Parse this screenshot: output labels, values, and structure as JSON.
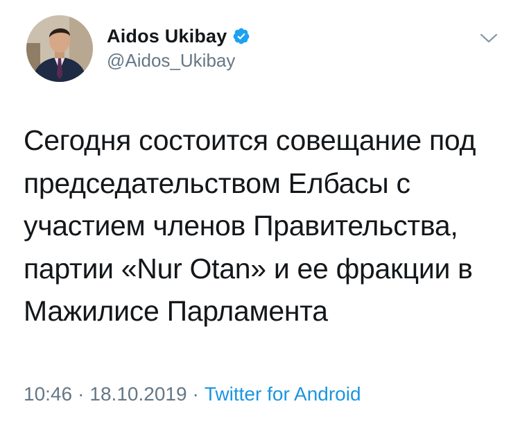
{
  "author": {
    "display_name": "Aidos Ukibay",
    "handle": "@Aidos_Ukibay",
    "verified": true,
    "verified_icon": "verified-badge-icon",
    "avatar_icon": "profile-photo"
  },
  "tweet": {
    "lines": [
      "Сегодня состоится совещание под",
      "председательством Елбасы с",
      "участием членов Правительства,",
      "партии «Nur Otan» и ее фракции в",
      "Мажилисе Парламента"
    ]
  },
  "meta": {
    "time": "10:46",
    "separator": "·",
    "date": "18.10.2019",
    "source": "Twitter for Android"
  },
  "menu_icon": "chevron-down-icon",
  "colors": {
    "text": "#14171a",
    "secondary": "#657786",
    "link": "#1b95e0",
    "verified": "#1da1f2"
  }
}
